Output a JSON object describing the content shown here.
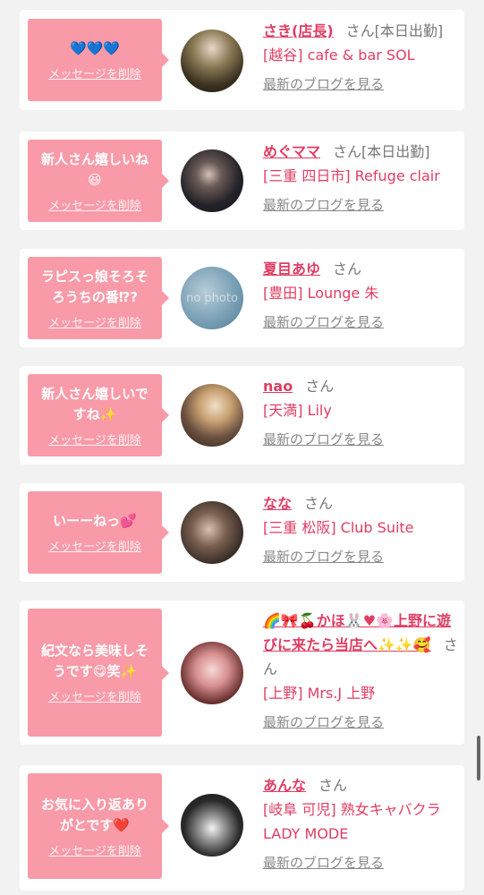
{
  "delete_label": "メッセージを削除",
  "blog_label": "最新のブログを見る",
  "san_label": "さん",
  "cards": [
    {
      "message": "💙💙💙",
      "name": "さき(店長)",
      "status": "[本日出勤]",
      "shop": "[越谷] cafe & bar SOL"
    },
    {
      "message": "新人さん嬉しいね😆",
      "name": "めぐママ",
      "status": "[本日出勤]",
      "shop": "[三重 四日市] Refuge clair"
    },
    {
      "message": "ラピスっ娘そろそろうちの番⁉︎?",
      "name": "夏目あゆ",
      "status": "",
      "shop": "[豊田] Lounge 朱",
      "avatar_text": "no photo"
    },
    {
      "message": "新人さん嬉しいですね✨",
      "name": "nao",
      "status": "",
      "shop": "[天満] Lily"
    },
    {
      "message": "いーーねっ💕",
      "name": "なな",
      "status": "",
      "shop": "[三重 松阪] Club Suite"
    },
    {
      "message": "紀文なら美味しそうです😋笑✨",
      "name": "🌈🎀🍒かほ🐰♥🌸上野に遊びに来たら当店へ✨✨🥰",
      "status": "",
      "shop": "[上野] Mrs.J 上野"
    },
    {
      "message": "お気に入り返ありがとです❤️",
      "name": "あんな",
      "status": "",
      "shop": "[岐阜 可児] 熟女キャバクラ LADY MODE"
    }
  ]
}
